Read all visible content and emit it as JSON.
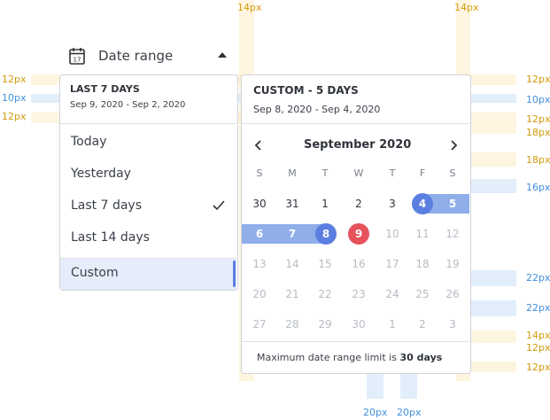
{
  "spacing_labels": {
    "top_left_14": "14px",
    "top_right_14": "14px",
    "left_12a": "12px",
    "left_10": "10px",
    "left_12b": "12px",
    "r_12a": "12px",
    "r_10": "10px",
    "r_12b": "12px",
    "r_18a": "18px",
    "r_18b": "18px",
    "r_16": "16px",
    "r_22a": "22px",
    "r_22b": "22px",
    "r_14": "14px",
    "r_12c": "12px",
    "r_12d": "12px",
    "bottom_20a": "20px",
    "bottom_20b": "20px"
  },
  "header": {
    "label": "Date range",
    "icon_day": "17"
  },
  "presets": {
    "active_title": "LAST 7 DAYS",
    "active_range": "Sep 9, 2020 - Sep 2, 2020",
    "options": [
      "Today",
      "Yesterday",
      "Last 7 days",
      "Last 14 days"
    ],
    "checked_option": "Last 7 days",
    "custom_label": "Custom"
  },
  "calendar": {
    "title": "CUSTOM - 5 DAYS",
    "range": "Sep 8, 2020 - Sep 4, 2020",
    "month": "September 2020",
    "weekdays": [
      "S",
      "M",
      "T",
      "W",
      "T",
      "F",
      "S"
    ],
    "weeks": [
      [
        "30",
        "31",
        "1",
        "2",
        "3",
        "4",
        "5"
      ],
      [
        "6",
        "7",
        "8",
        "9",
        "10",
        "11",
        "12"
      ],
      [
        "13",
        "14",
        "15",
        "16",
        "17",
        "18",
        "19"
      ],
      [
        "20",
        "21",
        "22",
        "23",
        "24",
        "25",
        "26"
      ],
      [
        "27",
        "28",
        "29",
        "30",
        "1",
        "2",
        "3"
      ]
    ],
    "range_start": "4",
    "range_end": "8",
    "today": "9",
    "limit_prefix": "Maximum date range limit is",
    "limit_value": "30 days"
  },
  "colors": {
    "accent": "#5b7fe0",
    "range_band": "#8faeea",
    "today": "#e5525b",
    "custom_row_bg": "#e6ecf9"
  }
}
